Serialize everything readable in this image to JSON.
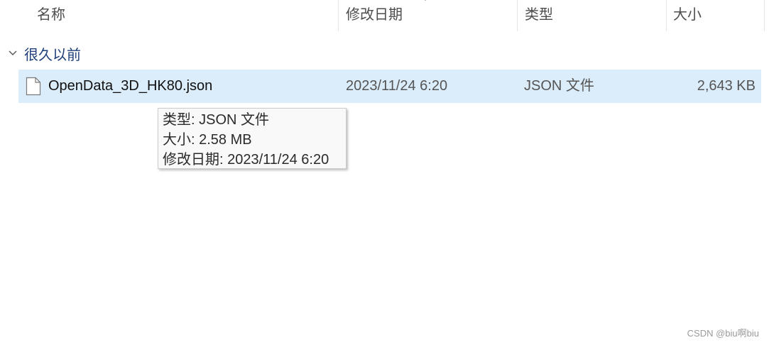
{
  "columns": {
    "name": "名称",
    "modified": "修改日期",
    "type": "类型",
    "size": "大小"
  },
  "group": {
    "label": "很久以前",
    "expanded": true
  },
  "files": [
    {
      "name": "OpenData_3D_HK80.json",
      "modified": "2023/11/24 6:20",
      "type": "JSON 文件",
      "size": "2,643 KB",
      "selected": true
    }
  ],
  "tooltip": {
    "type_line": "类型: JSON 文件",
    "size_line": "大小: 2.58 MB",
    "modified_line": "修改日期: 2023/11/24 6:20"
  },
  "watermark": "CSDN @biu啊biu",
  "colors": {
    "selection": "#dbecfa",
    "group_label": "#1f3f7a",
    "tooltip_bg": "#f9f9f9"
  }
}
